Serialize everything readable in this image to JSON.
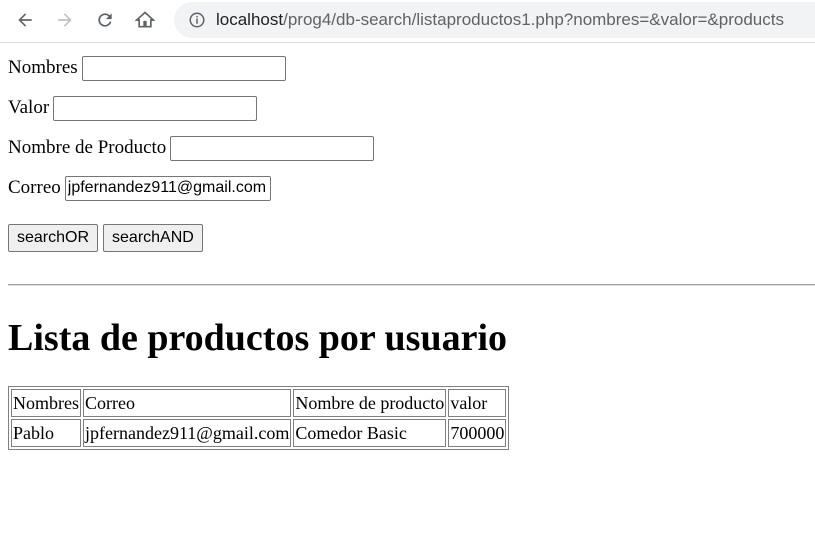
{
  "browser": {
    "url_host": "localhost",
    "url_path": "/prog4/db-search/listaproductos1.php?nombres=&valor=&products"
  },
  "form": {
    "nombres": {
      "label": "Nombres",
      "value": ""
    },
    "valor": {
      "label": "Valor",
      "value": ""
    },
    "producto": {
      "label": "Nombre de Producto",
      "value": ""
    },
    "correo": {
      "label": "Correo",
      "value": "jpfernandez911@gmail.com"
    },
    "btn_or": "searchOR",
    "btn_and": "searchAND"
  },
  "heading": "Lista de productos por usuario",
  "table": {
    "headers": [
      "Nombres",
      "Correo",
      "Nombre de producto",
      "valor"
    ],
    "rows": [
      [
        "Pablo",
        "jpfernandez911@gmail.com",
        "Comedor Basic",
        "700000"
      ]
    ]
  }
}
